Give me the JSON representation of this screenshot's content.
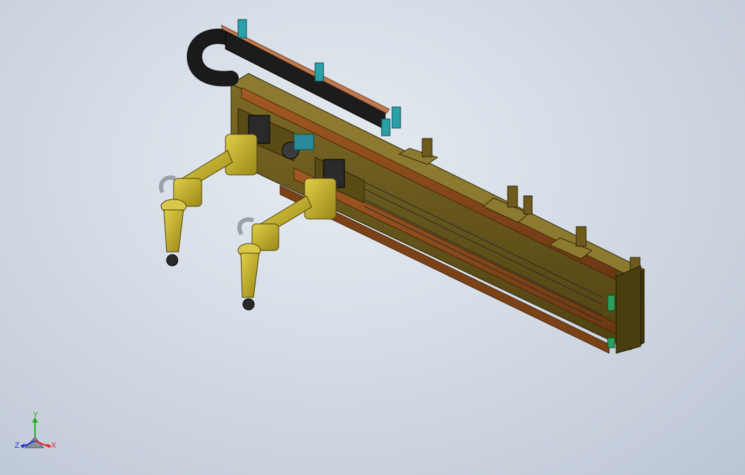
{
  "triad": {
    "x_label": "X",
    "y_label": "Y",
    "z_label": "Z",
    "x_color": "#e02020",
    "y_color": "#20b020",
    "z_color": "#2030d0"
  },
  "model": {
    "frame_color": "#6e5a1c",
    "rail_color": "#8a4a1a",
    "robot_color": "#c8b22a",
    "cable_chain_color": "#1c1c1c",
    "bracket_color": "#2aa0a8"
  }
}
